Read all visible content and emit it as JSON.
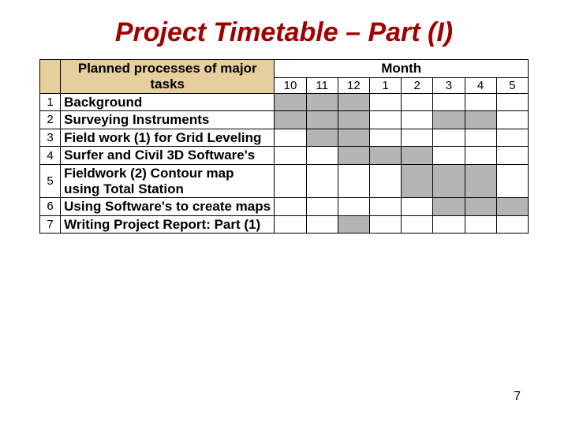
{
  "title": "Project Timetable – Part (I)",
  "header": {
    "tasks_label": "Planned processes of major tasks",
    "month_label": "Month"
  },
  "months": [
    "10",
    "11",
    "12",
    "1",
    "2",
    "3",
    "4",
    "5"
  ],
  "rows": [
    {
      "n": "1",
      "task": "Background",
      "bars": [
        1,
        1,
        1,
        0,
        0,
        0,
        0,
        0
      ]
    },
    {
      "n": "2",
      "task": "Surveying Instruments",
      "bars": [
        1,
        1,
        1,
        0,
        0,
        1,
        1,
        0
      ]
    },
    {
      "n": "3",
      "task": "Field work (1) for Grid Leveling",
      "bars": [
        0,
        1,
        1,
        0,
        0,
        0,
        0,
        0
      ]
    },
    {
      "n": "4",
      "task": "Surfer and Civil 3D Software's",
      "bars": [
        0,
        0,
        1,
        1,
        1,
        0,
        0,
        0
      ]
    },
    {
      "n": "5",
      "task": "Fieldwork (2) Contour map using Total Station",
      "bars": [
        0,
        0,
        0,
        0,
        1,
        1,
        1,
        0
      ]
    },
    {
      "n": "6",
      "task": "Using Software's to create maps",
      "bars": [
        0,
        0,
        0,
        0,
        0,
        1,
        1,
        1
      ]
    },
    {
      "n": "7",
      "task": "Writing Project Report: Part (1)",
      "bars": [
        0,
        0,
        1,
        0,
        0,
        0,
        0,
        0
      ]
    }
  ],
  "page_number": "7",
  "chart_data": {
    "type": "table",
    "title": "Project Timetable – Part (I)",
    "xlabel": "Month",
    "ylabel": "Planned processes of major tasks",
    "categories": [
      "10",
      "11",
      "12",
      "1",
      "2",
      "3",
      "4",
      "5"
    ],
    "series": [
      {
        "name": "Background",
        "values": [
          1,
          1,
          1,
          0,
          0,
          0,
          0,
          0
        ]
      },
      {
        "name": "Surveying Instruments",
        "values": [
          1,
          1,
          1,
          0,
          0,
          1,
          1,
          0
        ]
      },
      {
        "name": "Field work (1) for Grid Leveling",
        "values": [
          0,
          1,
          1,
          0,
          0,
          0,
          0,
          0
        ]
      },
      {
        "name": "Surfer and Civil 3D Software's",
        "values": [
          0,
          0,
          1,
          1,
          1,
          0,
          0,
          0
        ]
      },
      {
        "name": "Fieldwork (2) Contour map using Total Station",
        "values": [
          0,
          0,
          0,
          0,
          1,
          1,
          1,
          0
        ]
      },
      {
        "name": "Using Software's to create maps",
        "values": [
          0,
          0,
          0,
          0,
          0,
          1,
          1,
          1
        ]
      },
      {
        "name": "Writing Project Report: Part (1)",
        "values": [
          0,
          0,
          1,
          0,
          0,
          0,
          0,
          0
        ]
      }
    ]
  }
}
